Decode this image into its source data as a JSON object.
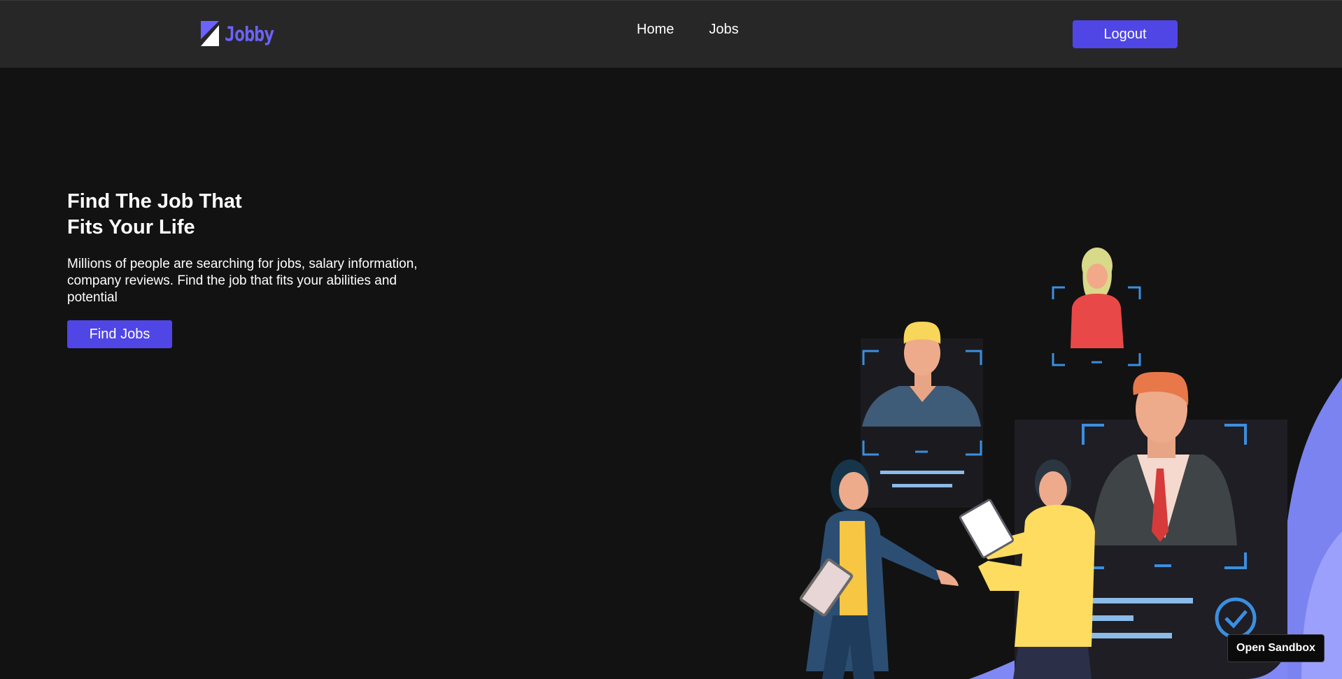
{
  "brand": {
    "name": "Jobby",
    "logo_icon": "jobby-logo-icon",
    "accent": "#4f46e5"
  },
  "nav": {
    "links": [
      {
        "label": "Home"
      },
      {
        "label": "Jobs"
      }
    ],
    "logout_label": "Logout"
  },
  "hero": {
    "title_line1": "Find The Job That",
    "title_line2": "Fits Your Life",
    "description": "Millions of people are searching for jobs, salary information, company reviews. Find the job that fits your abilities and potential",
    "cta_label": "Find Jobs"
  },
  "sandbox": {
    "label": "Open Sandbox"
  }
}
